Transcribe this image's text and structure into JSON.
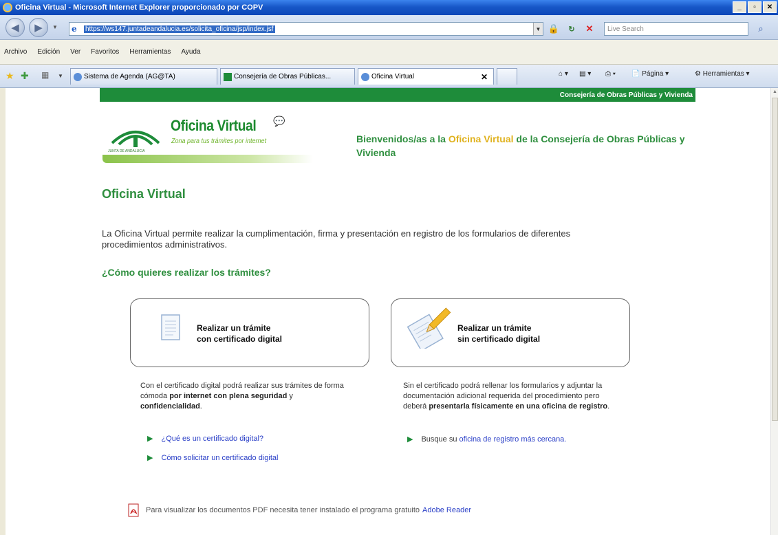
{
  "window": {
    "title": "Oficina Virtual - Microsoft Internet Explorer proporcionado por COPV"
  },
  "address": {
    "url": "https://ws147.juntadeandalucia.es/solicita_oficina/jsp/index.jsf",
    "search_placeholder": "Live Search"
  },
  "menu": [
    "Archivo",
    "Edición",
    "Ver",
    "Favoritos",
    "Herramientas",
    "Ayuda"
  ],
  "tabs": [
    {
      "label": "Sistema de Agenda (AG@TA)"
    },
    {
      "label": "Consejería de Obras Públicas..."
    },
    {
      "label": "Oficina Virtual"
    }
  ],
  "toolbar_right": {
    "page": "Página",
    "tools": "Herramientas"
  },
  "page": {
    "header_bar": "Consejería de Obras Públicas y Vivienda",
    "logo": {
      "title": "Oficina Virtual",
      "subtitle": "Zona para tus trámites por internet",
      "crest": "JUNTA DE ANDALUCIA"
    },
    "welcome": {
      "pre": "Bienvenidos/as a la ",
      "highlight": "Oficina Virtual",
      "post": " de la Consejería de Obras Públicas y Vivienda"
    },
    "title": "Oficina Virtual",
    "intro": "La Oficina Virtual permite realizar la cumplimentación, firma y presentación en registro de los formularios de diferentes procedimientos administrativos.",
    "question": "¿Cómo quieres realizar los trámites?",
    "option_with": {
      "line1": "Realizar un trámite",
      "line2": "con certificado digital"
    },
    "option_without": {
      "line1": "Realizar un trámite",
      "line2": "sin certificado digital"
    },
    "desc_with": {
      "a": "Con el certificado digital podrá realizar sus trámites de forma cómoda ",
      "b": "por internet con plena seguridad",
      "c": " y ",
      "d": "confidencialidad",
      "e": "."
    },
    "desc_without": {
      "a": "Sin el certificado podrá rellenar los formularios y adjuntar la documentación adicional requerida del procedimiento pero deberá ",
      "b": "presentarla físicamente en una oficina de registro",
      "c": "."
    },
    "link_what": "¿Qué es un certificado digital?",
    "link_how": "Cómo solicitar un certificado digital",
    "link_office_pre": "Busque su",
    "link_office": "oficina de registro más cercana.",
    "pdf_note": "Para visualizar los documentos PDF necesita tener instalado el programa gratuito",
    "pdf_link": "Adobe Reader"
  },
  "colors": {
    "green": "#1e8c3a",
    "title_green": "#2f8f3f",
    "highlight": "#e0b21e",
    "link": "#2a3fc7"
  }
}
